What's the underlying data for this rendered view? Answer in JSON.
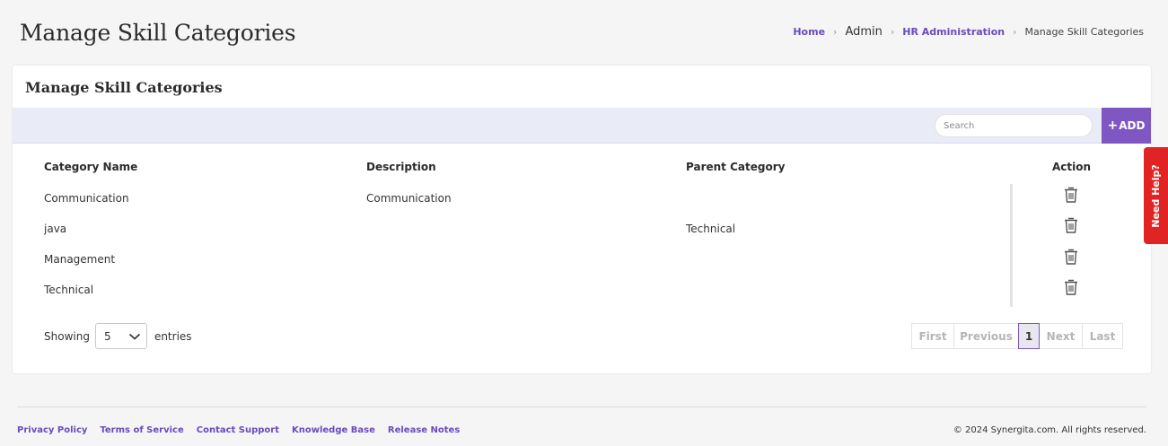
{
  "page": {
    "title": "Manage Skill Categories"
  },
  "breadcrumb": {
    "home": "Home",
    "admin": "Admin",
    "hr_admin": "HR Administration",
    "current": "Manage Skill Categories",
    "separator": ">"
  },
  "card": {
    "title": "Manage Skill Categories"
  },
  "toolbar": {
    "search_placeholder": "Search",
    "add_label": "ADD",
    "add_icon": "+"
  },
  "table": {
    "columns": [
      "Category Name",
      "Description",
      "Parent Category",
      "Action"
    ],
    "rows": [
      {
        "name": "Communication",
        "description": "Communication",
        "parent": ""
      },
      {
        "name": "java",
        "description": "",
        "parent": "Technical"
      },
      {
        "name": "Management",
        "description": "",
        "parent": ""
      },
      {
        "name": "Technical",
        "description": "",
        "parent": ""
      }
    ],
    "action_icon": "trash-icon"
  },
  "entries": {
    "label_before": "Showing",
    "value": "5",
    "label_after": "entries"
  },
  "pagination": {
    "first": "First",
    "previous": "Previous",
    "current": "1",
    "next": "Next",
    "last": "Last"
  },
  "help_tab": {
    "label": "Need Help?"
  },
  "footer": {
    "links": [
      "Privacy Policy",
      "Terms of Service",
      "Contact Support",
      "Knowledge Base",
      "Release Notes"
    ],
    "copyright": "© 2024 Synergita.com. All rights reserved."
  },
  "colors": {
    "accent": "#7e57c2",
    "link": "#6a4bbd",
    "toolbar_bg": "#e9ebf6",
    "help": "#e02424"
  }
}
